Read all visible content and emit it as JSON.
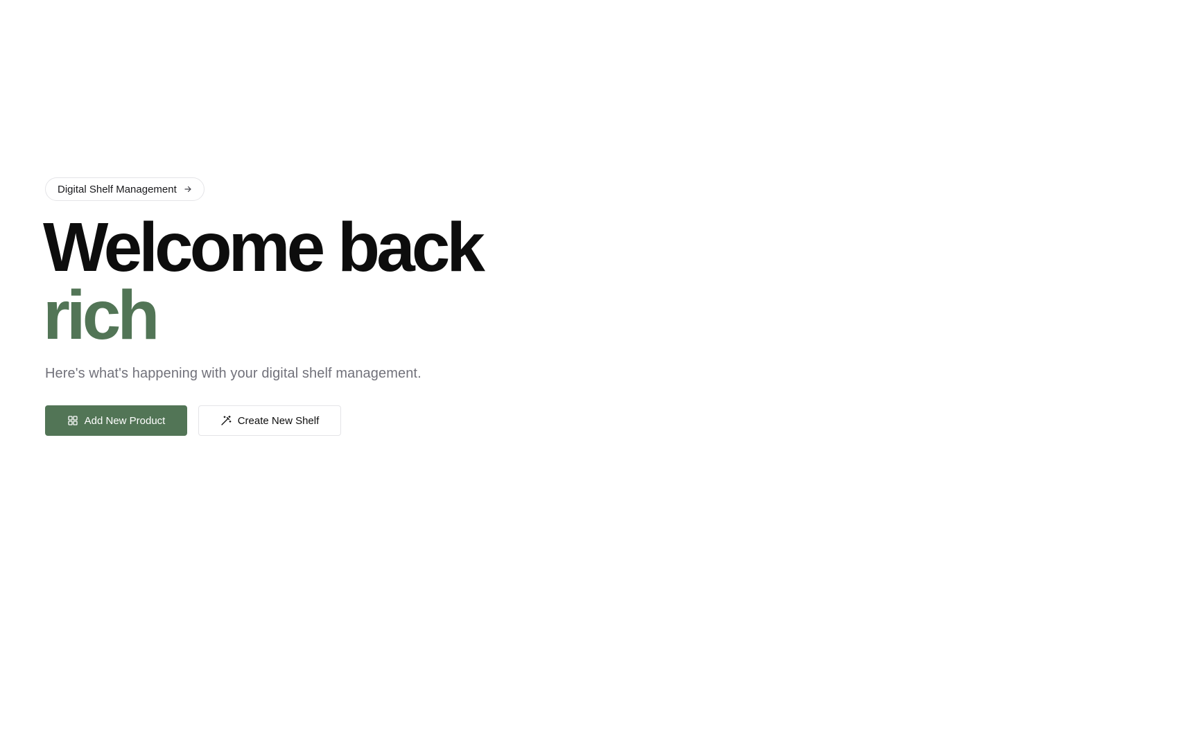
{
  "badge": {
    "label": "Digital Shelf Management",
    "icon": "arrow-right-icon"
  },
  "headline": {
    "line1": "Welcome back",
    "line2": "rich"
  },
  "subtitle": "Here's what's happening with your digital shelf management.",
  "actions": {
    "primary": {
      "label": "Add New Product",
      "icon": "grid-icon"
    },
    "secondary": {
      "label": "Create New Shelf",
      "icon": "magic-wand-icon"
    }
  },
  "colors": {
    "accent": "#527556",
    "text": "#0d0d0d",
    "muted": "#71717a",
    "border": "#e4e4e7"
  }
}
